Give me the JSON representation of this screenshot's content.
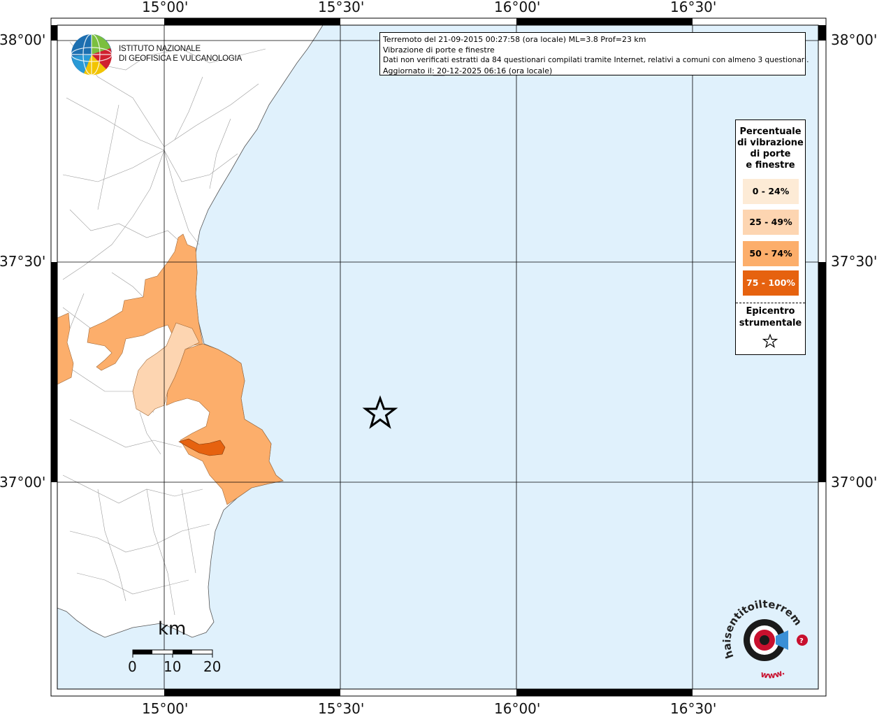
{
  "header_info": {
    "line1": "Terremoto del 21-09-2015 00:27:58 (ora locale) ML=3.8 Prof=23 km",
    "line2": "Vibrazione di porte e finestre",
    "line3": "Dati non verificati estratti da 84 questionari compilati tramite Internet, relativi a comuni con almeno 3 questionari.",
    "line4": "Aggiornato il: 20-12-2025 06:16 (ora locale)"
  },
  "institute": {
    "line1": "ISTITUTO NAZIONALE",
    "line2": "DI GEOFISICA E VULCANOLOGIA"
  },
  "axes": {
    "top": [
      "15°00'",
      "15°30'",
      "16°00'",
      "16°30'"
    ],
    "bottom": [
      "15°00'",
      "15°30'",
      "16°00'",
      "16°30'"
    ],
    "left": [
      "38°00'",
      "37°30'",
      "37°00'"
    ],
    "right": [
      "38°00'",
      "37°30'",
      "37°00'"
    ]
  },
  "legend": {
    "title_lines": [
      "Percentuale",
      "di vibrazione",
      "di porte",
      "e finestre"
    ],
    "classes": [
      {
        "label": "0 - 24%",
        "color": "#fdebd6"
      },
      {
        "label": "25 - 49%",
        "color": "#fdd5b1"
      },
      {
        "label": "50 - 74%",
        "color": "#fcae6b"
      },
      {
        "label": "75 - 100%",
        "color": "#e6620f"
      }
    ],
    "epicenter_lines": [
      "Epicentro",
      "strumentale"
    ]
  },
  "scale_bar": {
    "unit": "km",
    "labels": [
      "0",
      "10",
      "20"
    ]
  },
  "colors": {
    "sea": "#e0f1fc",
    "land": "#ffffff",
    "frame": "#000000",
    "grid": "#000000"
  },
  "haisentito_logo": {
    "text": "haisentitoilterremoto.it",
    "url_text": "www."
  }
}
